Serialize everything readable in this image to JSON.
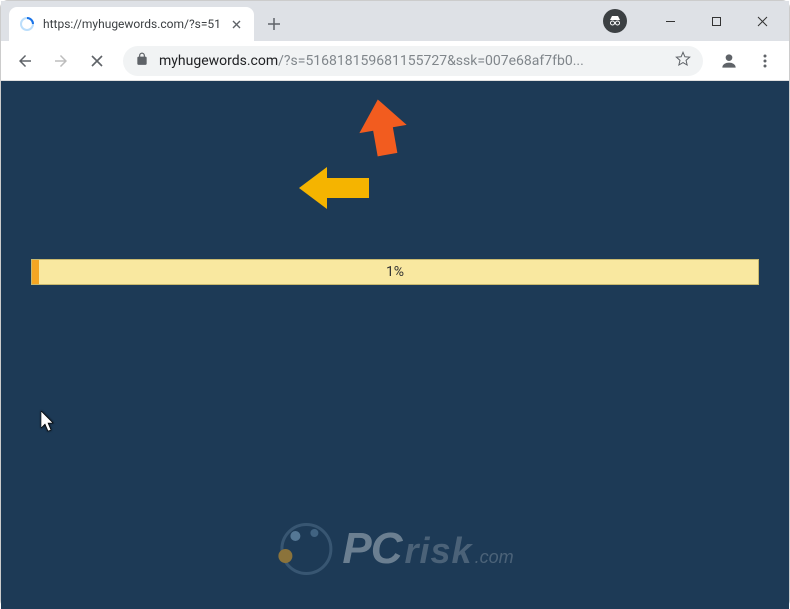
{
  "window": {
    "minimize_icon": "minimize",
    "maximize_icon": "maximize",
    "close_icon": "close"
  },
  "tab": {
    "title": "https://myhugewords.com/?s=51",
    "close_label": "×"
  },
  "toolbar": {
    "new_tab_label": "+",
    "url_domain": "myhugewords.com",
    "url_path": "/?s=516818159681155727&ssk=007e68af7fb0..."
  },
  "page": {
    "progress_percent": 1,
    "progress_label": "1%"
  },
  "watermark": {
    "pc": "PC",
    "risk": "risk",
    "dotcom": ".com"
  }
}
